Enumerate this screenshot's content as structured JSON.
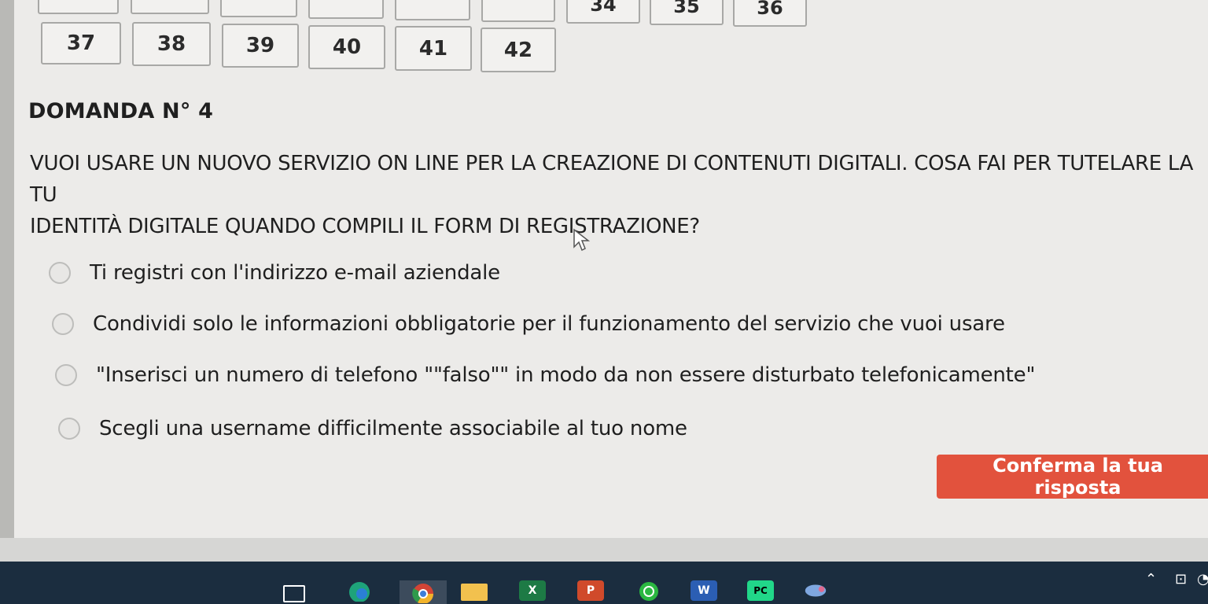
{
  "question_nav": {
    "row1": [
      "",
      "",
      "",
      "",
      "",
      "",
      "34",
      "35",
      "36"
    ],
    "row2": [
      "37",
      "38",
      "39",
      "40",
      "41",
      "42"
    ]
  },
  "question": {
    "title": "DOMANDA N° 4",
    "text": "VUOI USARE UN NUOVO SERVIZIO ON LINE PER LA CREAZIONE DI CONTENUTI DIGITALI. COSA FAI PER TUTELARE LA TU\nIDENTITÀ DIGITALE QUANDO COMPILI IL FORM DI REGISTRAZIONE?"
  },
  "options": [
    {
      "label": "Ti registri con l'indirizzo e-mail aziendale"
    },
    {
      "label": "Condividi solo le informazioni obbligatorie per il funzionamento del servizio che vuoi usare"
    },
    {
      "label": "\"Inserisci un numero di telefono \"\"falso\"\" in modo da non essere disturbato telefonicamente\""
    },
    {
      "label": "Scegli una username difficilmente associabile al tuo nome"
    }
  ],
  "confirm_label": "Conferma la tua risposta",
  "taskbar": {
    "icons": [
      "task-view-icon",
      "edge-icon",
      "chrome-icon",
      "file-explorer-icon",
      "excel-icon",
      "powerpoint-icon",
      "whatsapp-icon",
      "word-icon",
      "pycharm-icon",
      "app-icon"
    ],
    "excel_letter": "X",
    "powerpoint_letter": "P",
    "word_letter": "W",
    "pycharm_letters": "PC",
    "background": "#1b2d3f"
  },
  "colors": {
    "accent": "#e2523d",
    "page_bg": "#ecebe9",
    "text": "#1f1f1f"
  }
}
